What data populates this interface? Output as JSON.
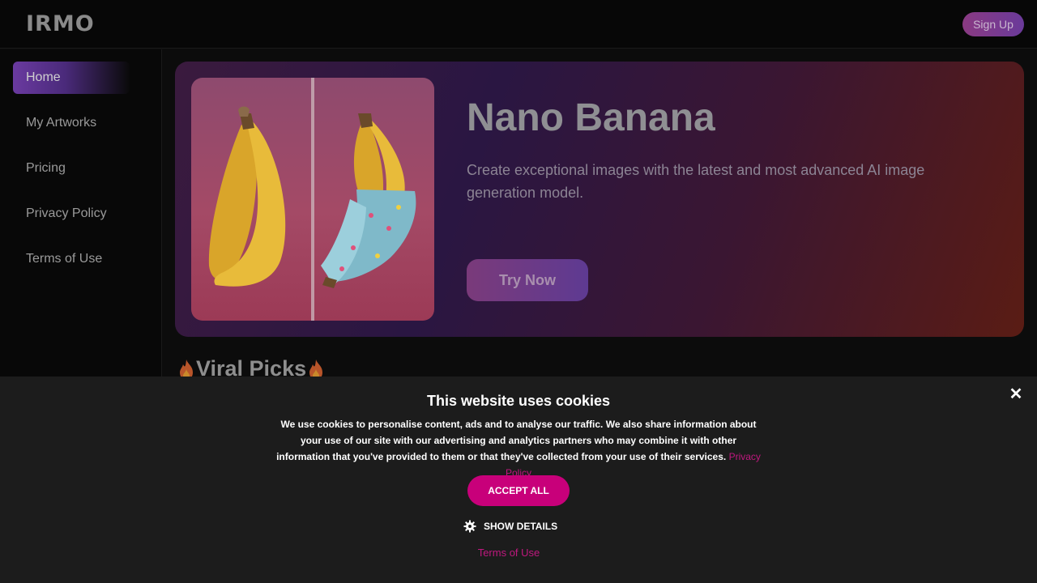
{
  "header": {
    "logo": "IRMO",
    "signup_label": "Sign Up"
  },
  "sidebar": {
    "items": [
      {
        "label": "Home",
        "active": true
      },
      {
        "label": "My Artworks",
        "active": false
      },
      {
        "label": "Pricing",
        "active": false
      },
      {
        "label": "Privacy Policy",
        "active": false
      },
      {
        "label": "Terms of Use",
        "active": false
      }
    ]
  },
  "hero": {
    "title": "Nano Banana",
    "description": "Create exceptional images with the latest and most advanced AI image generation model.",
    "cta_label": "Try Now",
    "image_icon": "banana-before-after-image"
  },
  "section": {
    "title": "Viral Picks",
    "icon": "fire-icon"
  },
  "cookie_banner": {
    "title": "This website uses cookies",
    "body": "We use cookies to personalise content, ads and to analyse our traffic. We also share information about your use of our site with our advertising and analytics partners who may combine it with other information that you've provided to them or that they've collected from your use of their services.",
    "privacy_link": "Privacy Policy",
    "accept_label": "ACCEPT ALL",
    "details_label": "SHOW DETAILS",
    "terms_link": "Terms of Use",
    "close_icon": "close-icon",
    "accent_color": "#c8007a"
  }
}
